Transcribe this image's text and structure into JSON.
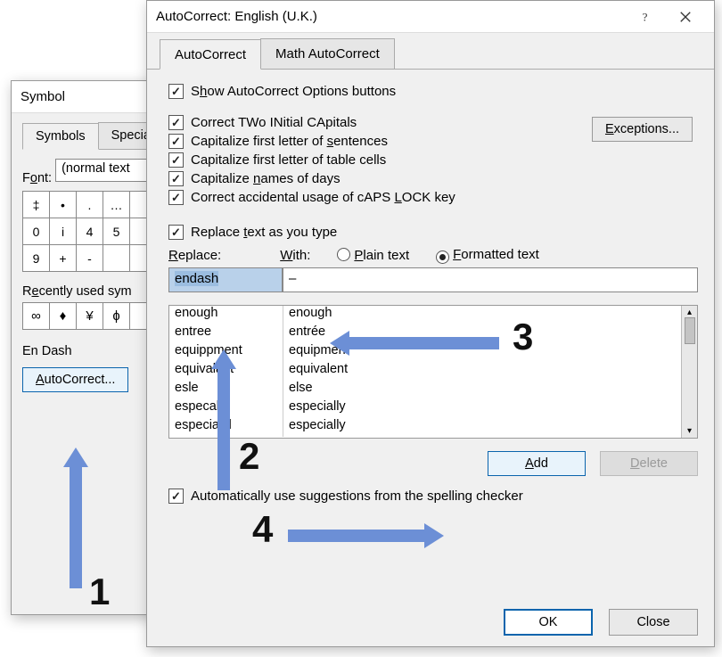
{
  "symbol_window": {
    "title": "Symbol",
    "tabs": {
      "symbols": "Symbols",
      "special": "Special"
    },
    "font_label_pre": "F",
    "font_label_u": "o",
    "font_label_post": "nt:",
    "font_value": "(normal text",
    "grid_cells": [
      "‡",
      "•",
      ".",
      "…",
      " ",
      "0",
      "i",
      "4",
      "5",
      " ",
      "9",
      "+",
      "-",
      " ",
      " "
    ],
    "recent_label_pre": "R",
    "recent_label_u": "e",
    "recent_label_post": "cently used sym",
    "recent_cells": [
      "∞",
      "♦",
      "¥",
      "ɸ",
      " "
    ],
    "char_name": "En Dash",
    "autocorrect_btn_u": "A",
    "autocorrect_btn_rest": "utoCorrect..."
  },
  "ac_window": {
    "title": "AutoCorrect: English (U.K.)",
    "tabs": {
      "ac": "AutoCorrect",
      "math": "Math AutoCorrect"
    },
    "show_opts_pre": "S",
    "show_opts_u": "h",
    "show_opts_post": "ow AutoCorrect Options buttons",
    "two_caps": "Correct TWo INitial CApitals",
    "cap_sent_pre": "Capitalize first letter of ",
    "cap_sent_u": "s",
    "cap_sent_post": "entences",
    "cap_cells": "Capitalize first letter of table cells",
    "cap_days_pre": "Capitalize ",
    "cap_days_u": "n",
    "cap_days_post": "ames of days",
    "caps_lock_pre": "Correct accidental usage of cAPS ",
    "caps_lock_u": "L",
    "caps_lock_post": "OCK key",
    "exceptions_u": "E",
    "exceptions_rest": "xceptions...",
    "replace_chk_pre": "Replace ",
    "replace_chk_u": "t",
    "replace_chk_post": "ext as you type",
    "replace_label_u": "R",
    "replace_label_post": "eplace:",
    "with_label_u": "W",
    "with_label_post": "ith:",
    "plain_u": "P",
    "plain_post": "lain text",
    "formatted_u": "F",
    "formatted_post": "ormatted text",
    "replace_value": "endash",
    "with_value": "–",
    "rows": [
      {
        "r": "enough",
        "w": "enough"
      },
      {
        "r": "entree",
        "w": "entrée"
      },
      {
        "r": "equippment",
        "w": "equipment"
      },
      {
        "r": "equivalant",
        "w": "equivalent"
      },
      {
        "r": "esle",
        "w": "else"
      },
      {
        "r": "especally",
        "w": "especially"
      },
      {
        "r": "especialyl",
        "w": "especially"
      }
    ],
    "add_u": "A",
    "add_rest": "dd",
    "delete_u": "D",
    "delete_rest": "elete",
    "auto_sugg": "Automatically use suggestions from the spelling checker",
    "ok": "OK",
    "close": "Close"
  },
  "annotations": {
    "n1": "1",
    "n2": "2",
    "n3": "3",
    "n4": "4"
  }
}
